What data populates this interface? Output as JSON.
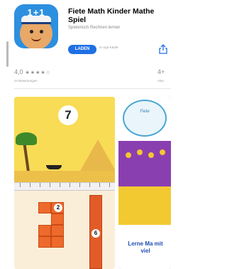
{
  "app": {
    "title": "Fiete Math Kinder Mathe Spiel",
    "subtitle": "Spielerisch Rechnen lernen",
    "icon_text": "1+1",
    "get_label": "LADEN",
    "iap_note": "In-App-Käufe",
    "share_icon": "share-icon"
  },
  "ratings": {
    "score": "4,0",
    "stars": "★★★★☆",
    "count_label": "24 Bewertungen",
    "age": "4+",
    "age_label": "Alter"
  },
  "screenshots": {
    "shot1": {
      "number_card": "7",
      "badge_a": "2",
      "badge_b": "6"
    },
    "shot2": {
      "badge_text": "Fiete",
      "promo_text": "Lerne Ma mit viel"
    }
  },
  "colors": {
    "accent": "#1f6fe5",
    "icon_bg": "#2d8fe0",
    "shot1_bg": "#f7d64b",
    "shot2_bg": "#e84b9c"
  }
}
